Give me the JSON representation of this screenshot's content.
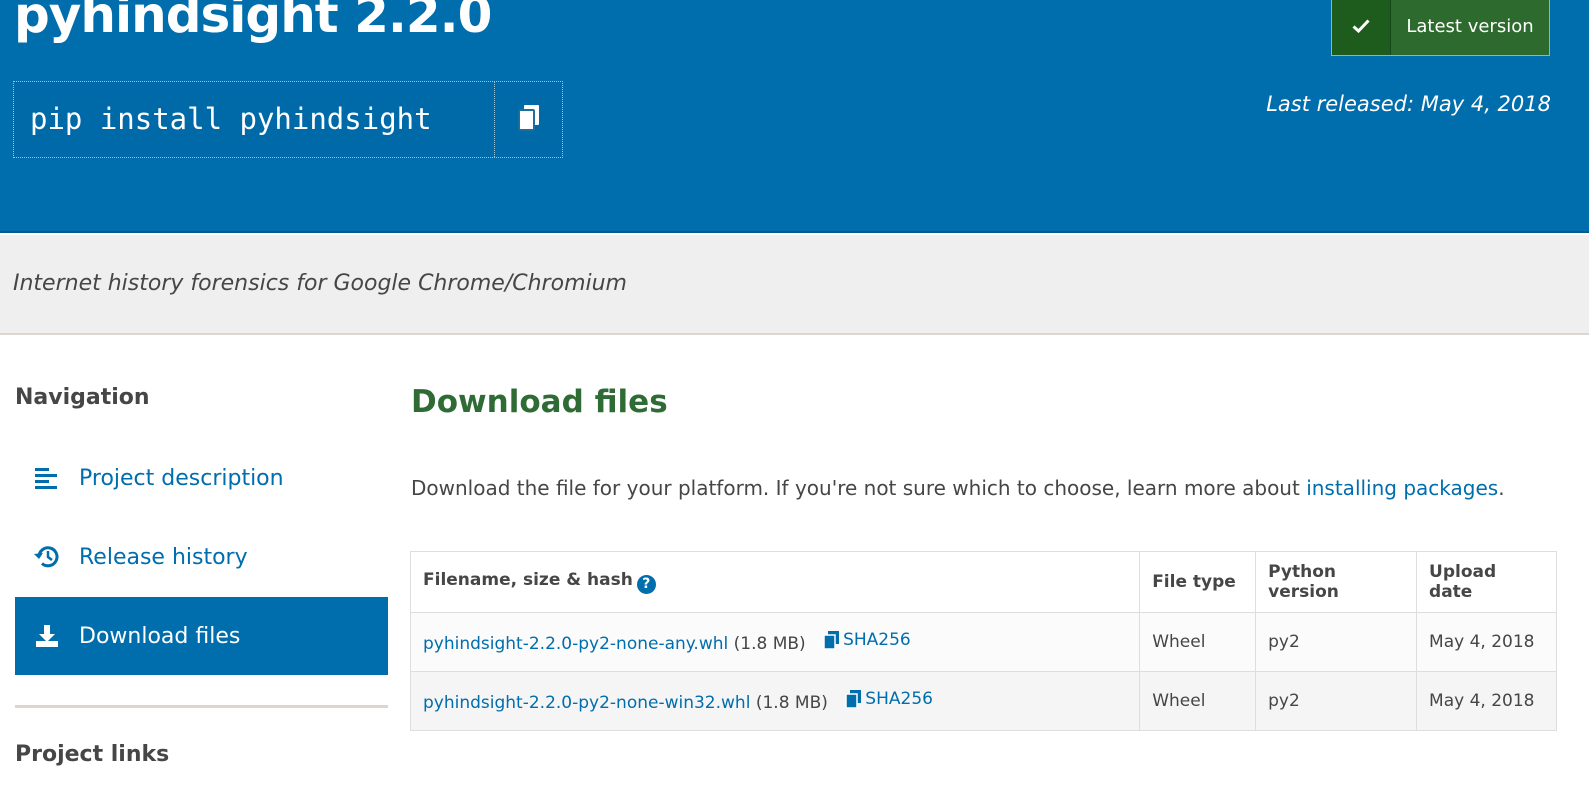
{
  "header": {
    "title": "pyhindsight 2.2.0",
    "pip_command": "pip install pyhindsight",
    "latest_label": "Latest version",
    "last_released": "Last released: May 4, 2018"
  },
  "summary": "Internet history forensics for Google Chrome/Chromium",
  "sidebar": {
    "heading": "Navigation",
    "items": [
      {
        "label": "Project description",
        "icon": "align-left-icon"
      },
      {
        "label": "Release history",
        "icon": "history-icon"
      },
      {
        "label": "Download files",
        "icon": "download-icon"
      }
    ],
    "links_heading": "Project links"
  },
  "main": {
    "heading": "Download files",
    "intro_text": "Download the file for your platform. If you're not sure which to choose, learn more about ",
    "intro_link": "installing packages",
    "intro_end": "."
  },
  "files_table": {
    "headers": [
      "Filename, size & hash",
      "File type",
      "Python version",
      "Upload date"
    ],
    "rows": [
      {
        "filename": "pyhindsight-2.2.0-py2-none-any.whl",
        "size": "(1.8 MB)",
        "hash": "SHA256",
        "type": "Wheel",
        "python": "py2",
        "date": "May 4, 2018"
      },
      {
        "filename": "pyhindsight-2.2.0-py2-none-win32.whl",
        "size": "(1.8 MB)",
        "hash": "SHA256",
        "type": "Wheel",
        "python": "py2",
        "date": "May 4, 2018"
      }
    ]
  },
  "colors": {
    "brand_blue": "#006dad",
    "heading_green": "#2f6b34",
    "latest_green": "#2d6a2d"
  }
}
